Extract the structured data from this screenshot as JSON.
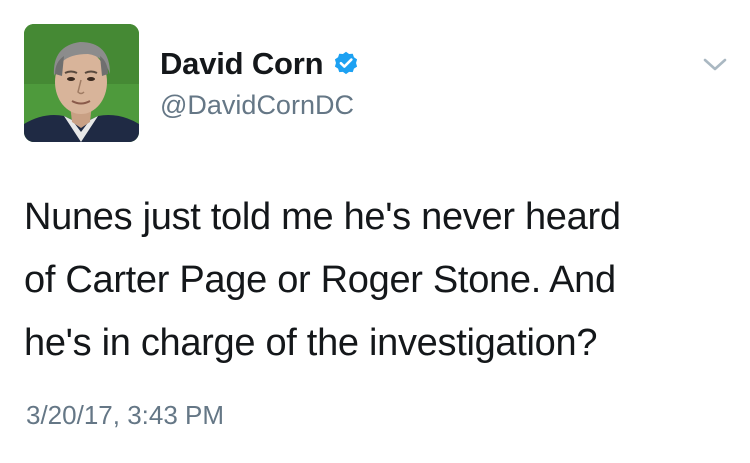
{
  "author": {
    "display_name": "David Corn",
    "handle": "@DavidCornDC",
    "avatar_icon": "profile-photo",
    "verified_icon": "verified-badge-icon",
    "verified_color": "#1da1f2"
  },
  "tweet": {
    "text": "Nunes just told me he's never heard\nof Carter Page or Roger Stone. And\nhe's in charge of the investigation?",
    "timestamp": "3/20/17, 3:43 PM"
  },
  "menu": {
    "icon": "chevron-down-icon"
  },
  "colors": {
    "text": "#14171a",
    "secondary": "#657786",
    "chevron": "#aab8c2"
  }
}
